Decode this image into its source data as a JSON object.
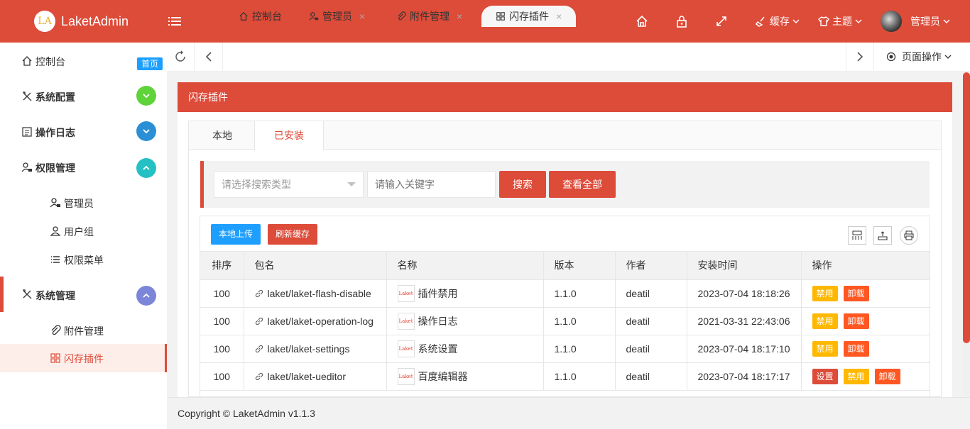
{
  "header": {
    "logo_mark": "LA",
    "app_name": "LaketAdmin",
    "cache_label": "缓存",
    "theme_label": "主题",
    "user_label": "管理员"
  },
  "sidebar": {
    "items": [
      {
        "label": "控制台",
        "badge": "首页"
      },
      {
        "label": "系统配置"
      },
      {
        "label": "操作日志"
      },
      {
        "label": "权限管理"
      },
      {
        "label": "管理员"
      },
      {
        "label": "用户组"
      },
      {
        "label": "权限菜单"
      },
      {
        "label": "系统管理"
      },
      {
        "label": "附件管理"
      },
      {
        "label": "闪存插件"
      }
    ]
  },
  "tabs": {
    "items": [
      {
        "label": "控制台"
      },
      {
        "label": "管理员",
        "close": "×"
      },
      {
        "label": "附件管理",
        "close": "×"
      },
      {
        "label": "闪存插件",
        "close": "×"
      }
    ],
    "page_ops": "页面操作"
  },
  "panel": {
    "title": "闪存插件",
    "subtabs": [
      "本地",
      "已安装"
    ]
  },
  "search": {
    "type_placeholder": "请选择搜索类型",
    "keyword_placeholder": "请输入关键字",
    "search_btn": "搜索",
    "view_all_btn": "查看全部"
  },
  "toolbar": {
    "upload_btn": "本地上传",
    "refresh_btn": "刷新缓存"
  },
  "table": {
    "columns": [
      "排序",
      "包名",
      "名称",
      "版本",
      "作者",
      "安装时间",
      "操作"
    ],
    "logo_text": "Laket",
    "rows": [
      {
        "order": "100",
        "pkg": "laket/laket-flash-disable",
        "name": "插件禁用",
        "version": "1.1.0",
        "author": "deatil",
        "time": "2023-07-04 18:18:26",
        "ops": [
          "禁用",
          "卸载"
        ]
      },
      {
        "order": "100",
        "pkg": "laket/laket-operation-log",
        "name": "操作日志",
        "version": "1.1.0",
        "author": "deatil",
        "time": "2021-03-31 22:43:06",
        "ops": [
          "禁用",
          "卸载"
        ]
      },
      {
        "order": "100",
        "pkg": "laket/laket-settings",
        "name": "系统设置",
        "version": "1.1.0",
        "author": "deatil",
        "time": "2023-07-04 18:17:10",
        "ops": [
          "禁用",
          "卸载"
        ]
      },
      {
        "order": "100",
        "pkg": "laket/laket-ueditor",
        "name": "百度编辑器",
        "version": "1.1.0",
        "author": "deatil",
        "time": "2023-07-04 18:17:17",
        "ops": [
          "设置",
          "禁用",
          "卸载"
        ]
      }
    ]
  },
  "footer": {
    "copyright": "Copyright © LaketAdmin v1.1.3"
  },
  "colors": {
    "primary": "#dd4b39",
    "blue": "#1e9fff",
    "green": "#5fd33a",
    "teal": "#25c0c4",
    "purple": "#7c86d9",
    "yellow": "#ffb800",
    "orange": "#ff5722"
  }
}
